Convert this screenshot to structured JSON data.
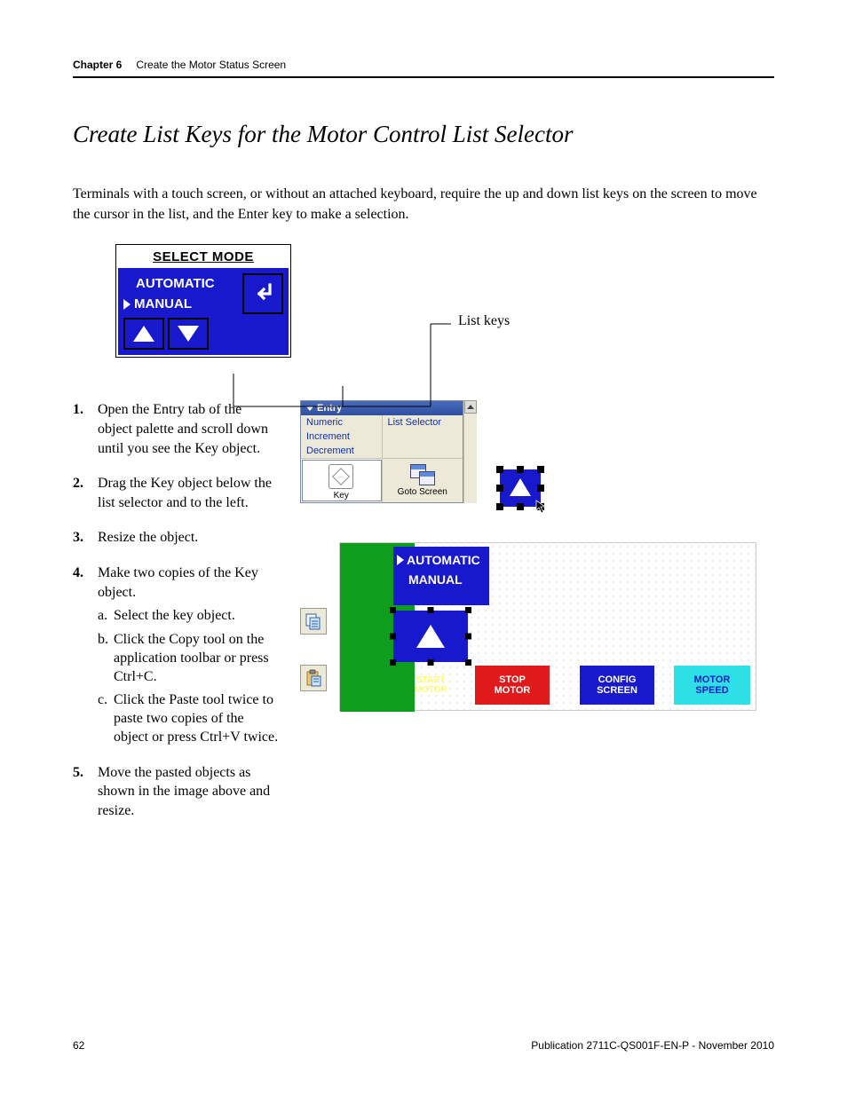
{
  "header": {
    "chapter": "Chapter 6",
    "title": "Create the Motor Status Screen"
  },
  "section_title": "Create List Keys for the Motor Control List Selector",
  "intro": "Terminals with a touch screen, or without an attached keyboard, require the up and down list keys on the screen to move the cursor in the list, and the Enter key to make a selection.",
  "fig1": {
    "heading": "SELECT MODE",
    "option_auto": "AUTOMATIC",
    "option_manual": "MANUAL",
    "callout_label": "List keys"
  },
  "steps": {
    "s1": "Open the Entry tab of the object palette and scroll down until you see the Key object.",
    "s2": "Drag the Key object below the list selector and to the left.",
    "s3": "Resize the object.",
    "s4": "Make two copies of the Key object.",
    "s4a_mark": "a.",
    "s4a": "Select the key object.",
    "s4b_mark": "b.",
    "s4b": "Click the Copy tool on the application toolbar or press Ctrl+C.",
    "s4c_mark": "c.",
    "s4c": "Click the Paste tool twice to paste two copies of the object or press Ctrl+V twice.",
    "s5": "Move the pasted objects as shown in the image above and resize."
  },
  "palette": {
    "title": "Entry",
    "link_numeric": "Numeric",
    "link_inc": "Increment",
    "link_dec": "Decrement",
    "link_list": "List Selector",
    "icon_key_label": "Key",
    "icon_goto_label": "Goto Screen"
  },
  "designer": {
    "list_auto": "AUTOMATIC",
    "list_manual": "MANUAL",
    "btn_start_l1": "START",
    "btn_start_l2": "MOTOR",
    "btn_stop_l1": "STOP",
    "btn_stop_l2": "MOTOR",
    "btn_config_l1": "CONFIG",
    "btn_config_l2": "SCREEN",
    "btn_speed_l1": "MOTOR",
    "btn_speed_l2": "SPEED"
  },
  "footer": {
    "page": "62",
    "pub": "Publication 2711C-QS001F-EN-P - November 2010"
  }
}
